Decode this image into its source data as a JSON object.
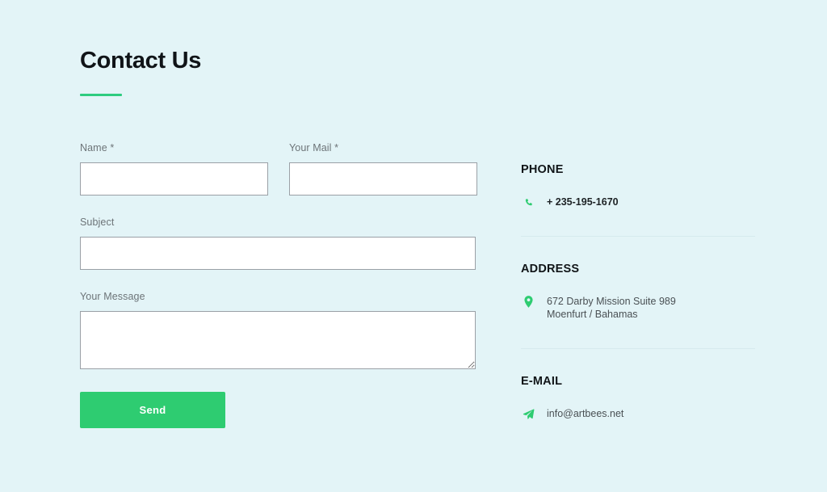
{
  "page": {
    "title": "Contact Us",
    "background_color": "#e3f4f7",
    "accent_color": "#2ecc71"
  },
  "form": {
    "fields": [
      {
        "label": "Name *",
        "value": "",
        "placeholder": "",
        "type": "text",
        "name": "name"
      },
      {
        "label": "Your Mail *",
        "value": "",
        "placeholder": "",
        "type": "text",
        "name": "email"
      },
      {
        "label": "Subject",
        "value": "",
        "placeholder": "",
        "type": "text",
        "name": "subject"
      },
      {
        "label": "Your Message",
        "value": "",
        "placeholder": "",
        "type": "textarea",
        "name": "message"
      }
    ],
    "submit_label": "Send"
  },
  "sidebar": {
    "groups": [
      {
        "heading": "PHONE",
        "icon": "phone-icon",
        "lines": [
          "+ 235-195-1670"
        ],
        "emphasis": true
      },
      {
        "heading": "ADDRESS",
        "icon": "map-pin-icon",
        "lines": [
          "672 Darby Mission Suite 989",
          "Moenfurt / Bahamas"
        ],
        "emphasis": false
      },
      {
        "heading": "E-MAIL",
        "icon": "paper-plane-icon",
        "lines": [
          "info@artbees.net"
        ],
        "emphasis": false
      }
    ]
  }
}
